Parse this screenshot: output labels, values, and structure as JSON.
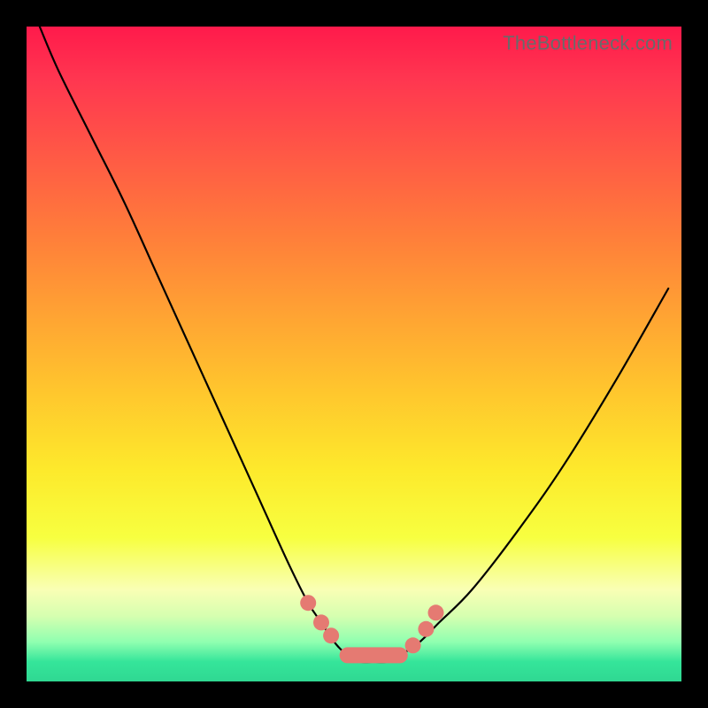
{
  "watermark": "TheBottleneck.com",
  "colors": {
    "background": "#000000",
    "gradient_top": "#ff1a4b",
    "gradient_bottom": "#2fd892",
    "curve_stroke": "#000000",
    "marker_fill": "#e57a72"
  },
  "chart_data": {
    "type": "line",
    "title": "",
    "xlabel": "",
    "ylabel": "",
    "xlim": [
      0,
      100
    ],
    "ylim": [
      0,
      100
    ],
    "grid": false,
    "legend": false,
    "annotations": [
      "TheBottleneck.com"
    ],
    "series": [
      {
        "name": "bottleneck-curve",
        "x": [
          2,
          5,
          10,
          15,
          20,
          25,
          30,
          35,
          40,
          43,
          45,
          47,
          49,
          51,
          53,
          55,
          57,
          60,
          63,
          68,
          75,
          82,
          90,
          98
        ],
        "y": [
          100,
          93,
          83,
          73,
          62,
          51,
          40,
          29,
          18,
          12,
          9,
          6,
          4,
          3,
          3,
          3,
          4,
          6,
          9,
          14,
          23,
          33,
          46,
          60
        ]
      }
    ],
    "markers": {
      "name": "highlight-points",
      "x": [
        43.0,
        45.0,
        46.5,
        49.0,
        52.0,
        55.0,
        57.0,
        59.0,
        61.0,
        62.5
      ],
      "y": [
        12.0,
        9.0,
        7.0,
        4.0,
        3.0,
        3.0,
        4.0,
        5.5,
        8.0,
        10.5
      ]
    }
  }
}
